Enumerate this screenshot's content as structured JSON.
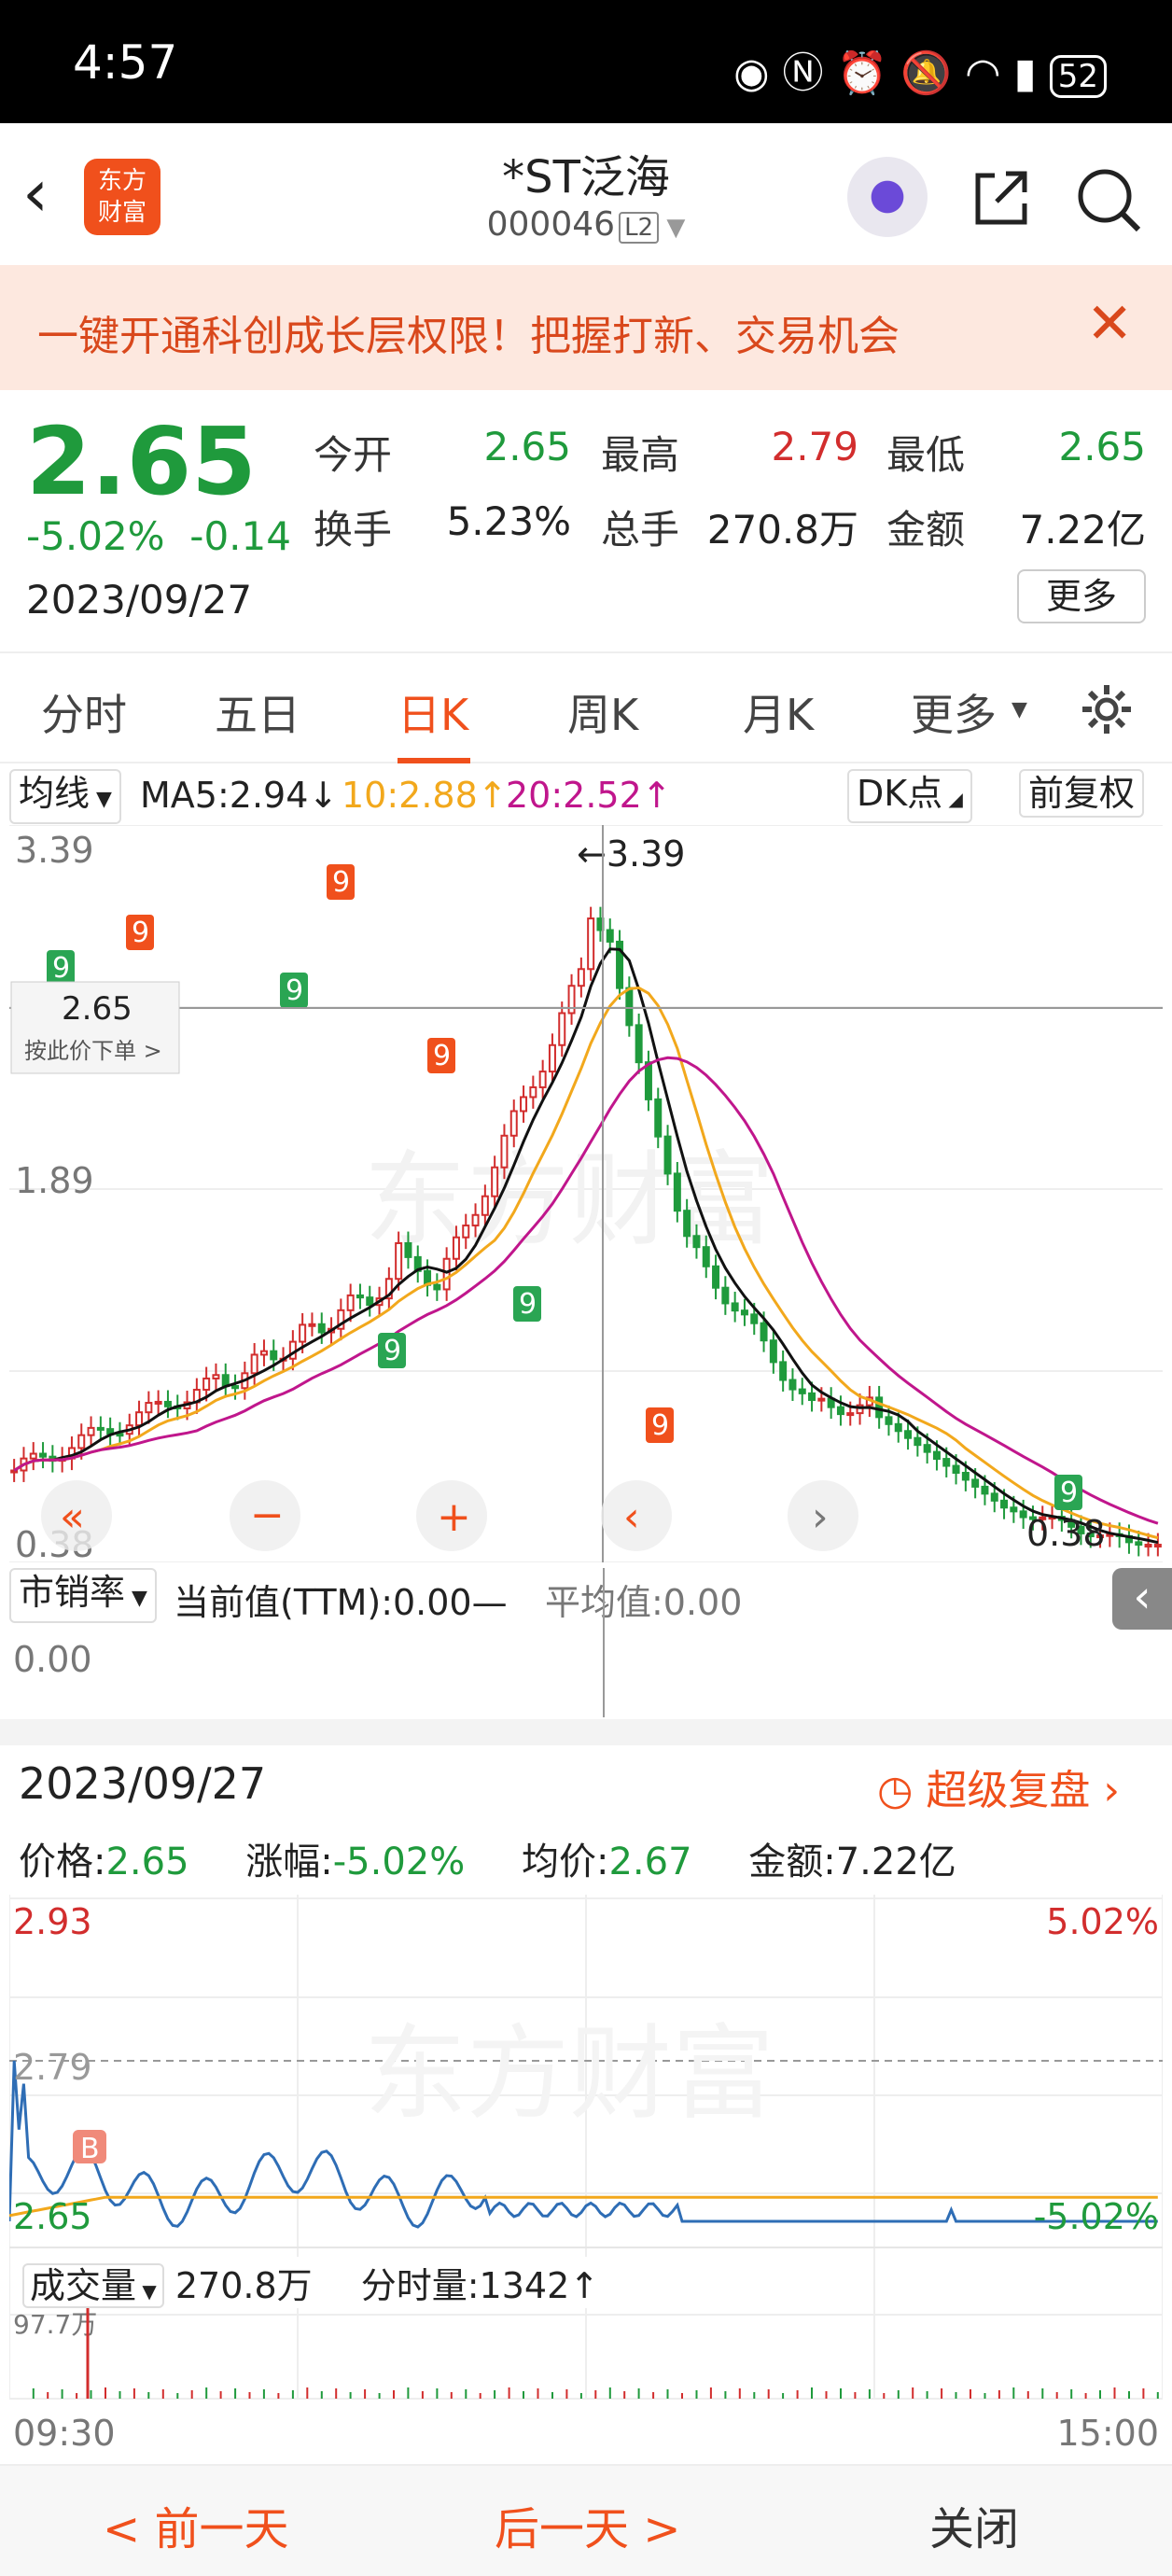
{
  "status_bar": {
    "time": "4:57",
    "battery": "52",
    "icons": [
      "eye-icon",
      "nfc-icon",
      "alarm-icon",
      "mute-icon",
      "wifi-icon",
      "signal-icon",
      "battery-icon"
    ]
  },
  "header": {
    "logo_line1": "东方",
    "logo_line2": "财富",
    "title": "*ST泛海",
    "code": "000046",
    "code_badge": "L2"
  },
  "banner": {
    "text": "一键开通科创成长层权限！把握打新、交易机会"
  },
  "quote": {
    "price": "2.65",
    "change_pct": "-5.02%",
    "change": "-0.14",
    "date": "2023/09/27",
    "fields": [
      {
        "label": "今开",
        "value": "2.65",
        "color": "green"
      },
      {
        "label": "最高",
        "value": "2.79",
        "color": "red"
      },
      {
        "label": "最低",
        "value": "2.65",
        "color": "green"
      },
      {
        "label": "换手",
        "value": "5.23%",
        "color": "black"
      },
      {
        "label": "总手",
        "value": "270.8万",
        "color": "black"
      },
      {
        "label": "金额",
        "value": "7.22亿",
        "color": "black"
      }
    ],
    "more": "更多"
  },
  "tabs": [
    "分时",
    "五日",
    "日K",
    "周K",
    "月K",
    "更多"
  ],
  "active_tab": "日K",
  "kbar": {
    "ma_select": "均线",
    "ma5": "MA5:2.94↓",
    "ma10": "10:2.88↑",
    "ma20": "20:2.52↑",
    "dk": "DK点",
    "adjust": "前复权"
  },
  "kchart": {
    "y_top": "3.39",
    "y_mid": "1.89",
    "y_bot": "0.38",
    "max_label": "←3.39",
    "min_label": "0.38",
    "crosshair_price": "2.65",
    "crosshair_action": "按此价下单 >",
    "colors": {
      "up": "#d22d2d",
      "down": "#1f9a3c",
      "ma5": "#111111",
      "ma10": "#f2a81c",
      "ma20": "#c0168c",
      "signal": "#f0501c"
    }
  },
  "pe": {
    "select": "市销率",
    "current": "当前值(TTM):0.00—",
    "avg": "平均值:0.00",
    "y0": "0.00"
  },
  "intraday": {
    "date": "2023/09/27",
    "replay": "超级复盘",
    "price_label": "价格:",
    "price": "2.65",
    "chg_label": "涨幅:",
    "chg": "-5.02%",
    "avg_label": "均价:",
    "avg": "2.67",
    "amt_label": "金额:",
    "amt": "7.22亿",
    "y_top": "2.93",
    "y_mid": "2.79",
    "y_bot": "2.65",
    "pct_top": "5.02%",
    "pct_bot": "-5.02%",
    "b_mark": "B",
    "vol_select": "成交量",
    "vol_total": "270.8万",
    "vol_now": "分时量:1342↑",
    "vol_max": "97.7万",
    "t_start": "09:30",
    "t_end": "15:00"
  },
  "bottom": {
    "prev": "< 前一天",
    "next": "后一天 >",
    "close": "关闭"
  },
  "watermark": "东方财富"
}
